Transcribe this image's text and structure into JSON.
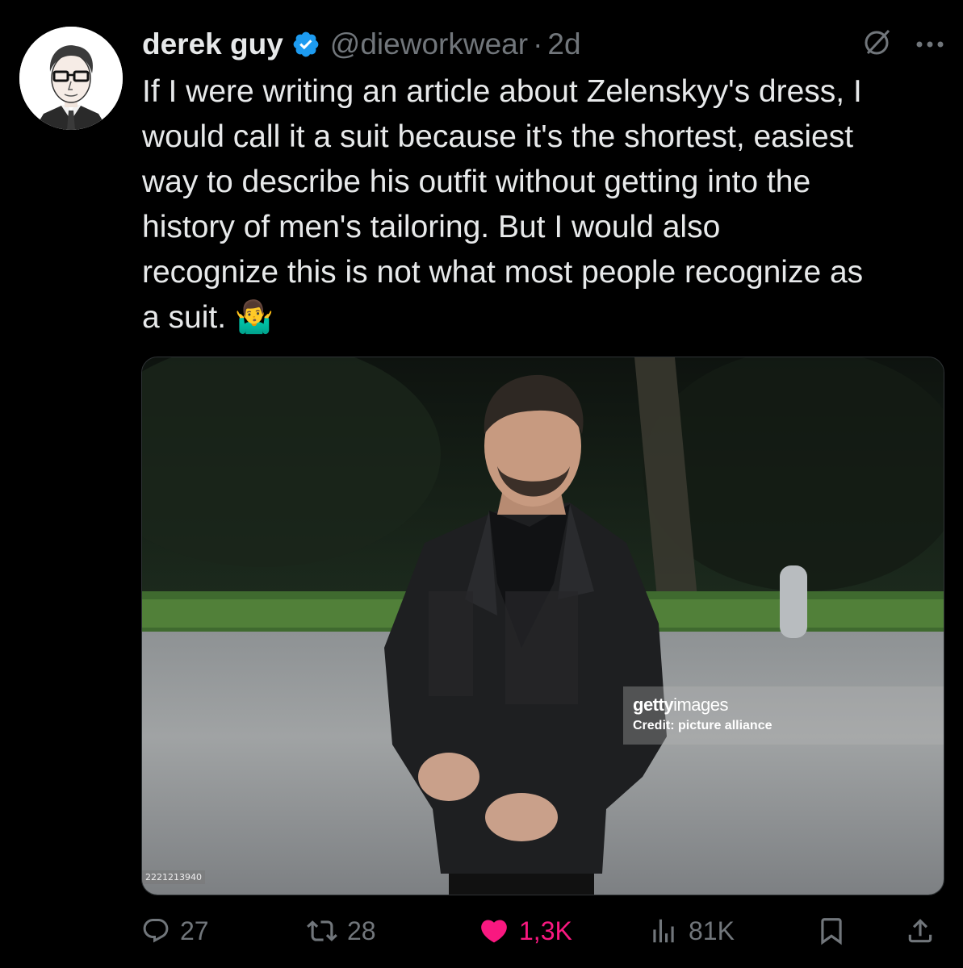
{
  "author": {
    "display_name": "derek guy",
    "handle": "@dieworkwear",
    "separator": "·",
    "time": "2d",
    "verified": true,
    "avatar_icon": "illustrated-portrait-avatar"
  },
  "header_actions": {
    "grok_icon": "slashed-circle-icon",
    "more_icon": "more-dots-icon"
  },
  "tweet": {
    "lines": [
      "If I were writing an article about Zelenskyy's dress, I",
      "would call it a suit because it's the shortest, easiest",
      "way to describe his outfit without getting into the",
      "history of men's tailoring. But I would also",
      "recognize this is not what most people recognize as",
      "a suit. 🤷‍♂️"
    ]
  },
  "media": {
    "watermark_brand_bold": "getty",
    "watermark_brand_light": "images",
    "watermark_credit": "Credit: picture alliance",
    "image_id": "2221213940"
  },
  "actions": {
    "replies": "27",
    "reposts": "28",
    "likes": "1,3K",
    "views": "81K"
  },
  "colors": {
    "background": "#000000",
    "text": "#e7e9ea",
    "muted": "#71767b",
    "verified": "#1d9bf0",
    "like": "#f91880"
  }
}
